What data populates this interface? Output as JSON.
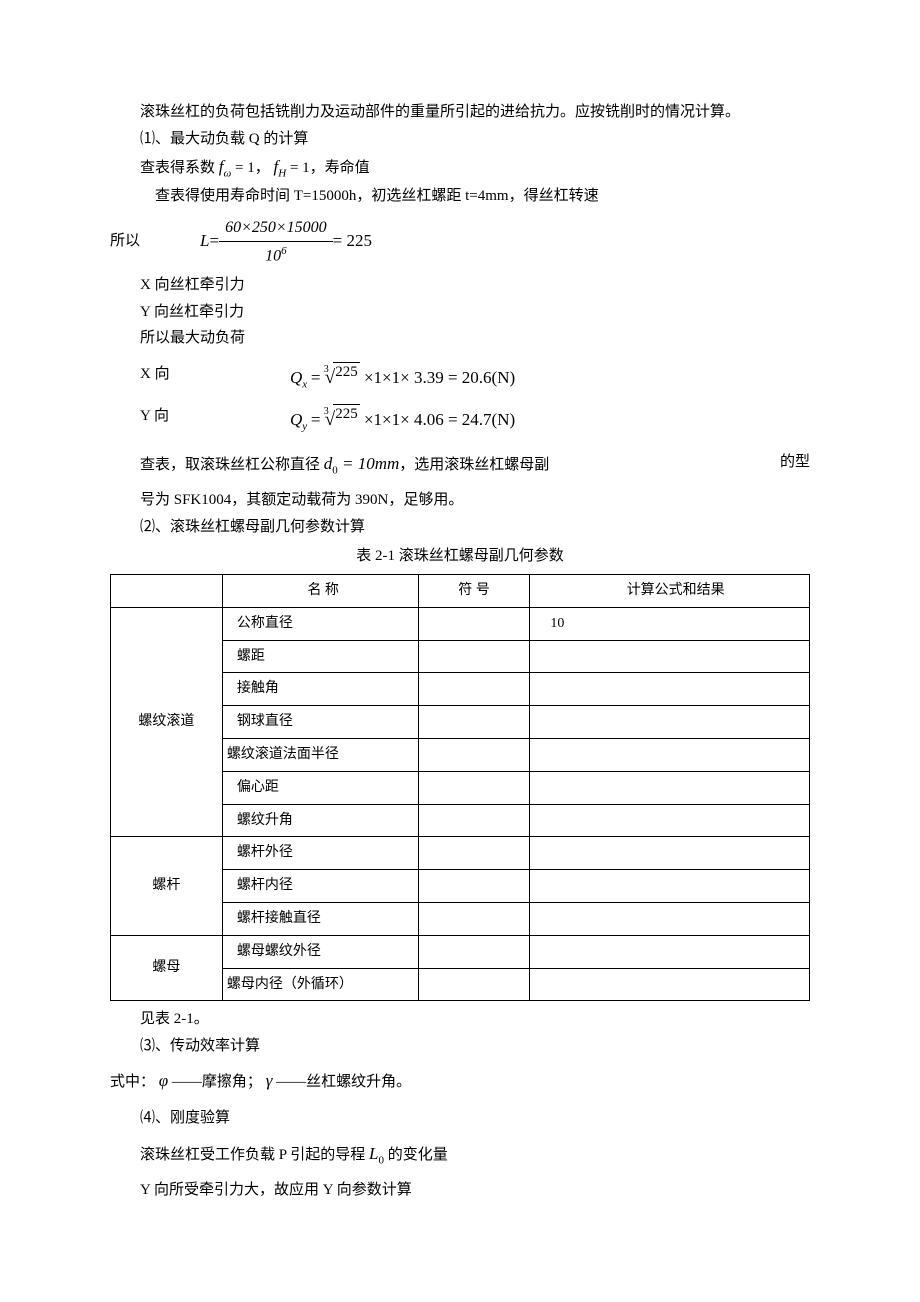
{
  "p1": "滚珠丝杠的负荷包括铣削力及运动部件的重量所引起的进给抗力。应按铣削时的情况计算。",
  "p2": "⑴、最大动负载 Q 的计算",
  "p3_prefix": "查表得系数",
  "p3_f1_sym": "f",
  "p3_f1_sub": "ω",
  "p3_f1_eq": " = 1，",
  "p3_f2_sym": "f",
  "p3_f2_sub": "H",
  "p3_f2_eq": " = 1，寿命值",
  "p4": "查表得使用寿命时间 T=15000h，初选丝杠螺距 t=4mm，得丝杠转速",
  "p5_prefix": "所以",
  "p5_L": "L",
  "p5_eq": " = ",
  "p5_num": "60×250×15000",
  "p5_den": "10",
  "p5_den_sup": "6",
  "p5_result": " = 225",
  "p6": "X 向丝杠牵引力",
  "p7": "Y 向丝杠牵引力",
  "p8": "所以最大动负荷",
  "xdir_label": "X 向",
  "xdir_sym": "Q",
  "xdir_sub": "x",
  "xdir_root_idx": "3",
  "xdir_root_val": "225",
  "xdir_tail": " ×1×1× 3.39 = 20.6(N)",
  "ydir_label": "Y 向",
  "ydir_sym": "Q",
  "ydir_sub": "y",
  "ydir_root_idx": "3",
  "ydir_root_val": "225",
  "ydir_tail": " ×1×1× 4.06 = 24.7(N)",
  "p9_a": "查表，取滚珠丝杠公称直径 ",
  "p9_sym": "d",
  "p9_sub": "0",
  "p9_val": " = 10mm",
  "p9_b": "，选用滚珠丝杠螺母副",
  "p9_c": "的型",
  "p10": "号为   SFK1004，其额定动载荷为 390N，足够用。",
  "p11": "⑵、滚珠丝杠螺母副几何参数计算",
  "table_title": "表 2-1    滚珠丝杠螺母副几何参数",
  "table": {
    "header": {
      "c2": "名        称",
      "c3": "符    号",
      "c4": "计算公式和结果"
    },
    "rows": [
      {
        "group": "螺纹滚道",
        "rowspan": 7,
        "name": "公称直径",
        "sym": "",
        "val": "10"
      },
      {
        "name": "螺距",
        "sym": "",
        "val": ""
      },
      {
        "name": "接触角",
        "sym": "",
        "val": ""
      },
      {
        "name": "钢球直径",
        "sym": "",
        "val": ""
      },
      {
        "name": "螺纹滚道法面半径",
        "sym": "",
        "val": ""
      },
      {
        "name": "偏心距",
        "sym": "",
        "val": ""
      },
      {
        "name": "螺纹升角",
        "sym": "",
        "val": ""
      },
      {
        "group": "螺杆",
        "rowspan": 3,
        "name": "螺杆外径",
        "sym": "",
        "val": ""
      },
      {
        "name": "螺杆内径",
        "sym": "",
        "val": ""
      },
      {
        "name": "螺杆接触直径",
        "sym": "",
        "val": ""
      },
      {
        "group": "螺母",
        "rowspan": 2,
        "name": "螺母螺纹外径",
        "sym": "",
        "val": ""
      },
      {
        "name": "螺母内径（外循环）",
        "sym": "",
        "val": ""
      }
    ]
  },
  "p12": "见表 2-1。",
  "p13": "⑶、传动效率计算",
  "p14_a": "式中：",
  "p14_phi": "φ",
  "p14_b": "——摩擦角；",
  "p14_gamma": "γ",
  "p14_c": "——丝杠螺纹升角。",
  "p15": "⑷、刚度验算",
  "p16_a": "滚珠丝杠受工作负载 P 引起的导程",
  "p16_sym": "L",
  "p16_sub": "0",
  "p16_b": "的变化量",
  "p17": "Y 向所受牵引力大，故应用 Y 向参数计算"
}
